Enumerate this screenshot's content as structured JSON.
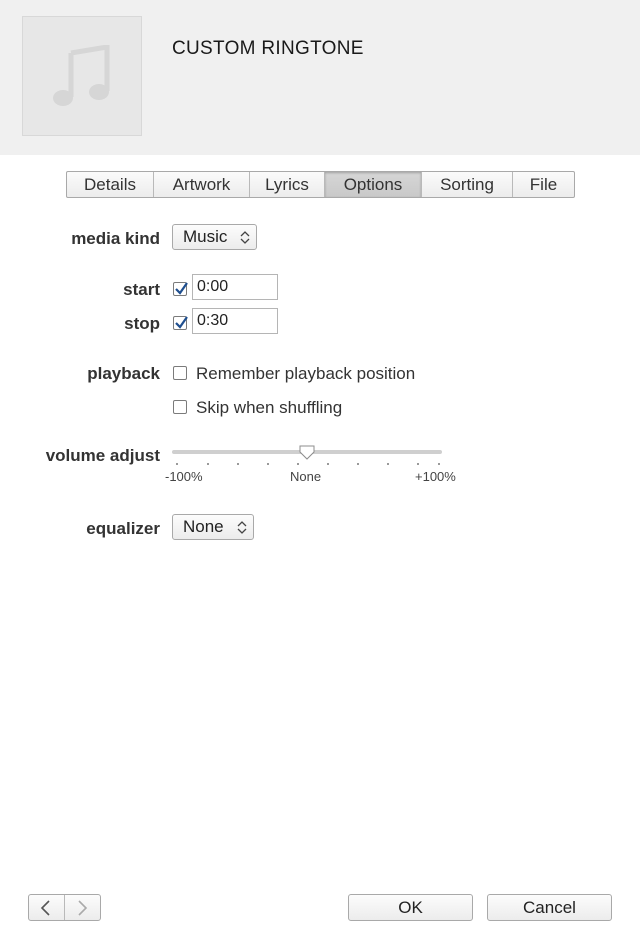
{
  "header": {
    "title": "CUSTOM RINGTONE",
    "artwork_icon": "music-note-icon"
  },
  "tabs": [
    {
      "label": "Details",
      "active": false
    },
    {
      "label": "Artwork",
      "active": false
    },
    {
      "label": "Lyrics",
      "active": false
    },
    {
      "label": "Options",
      "active": true
    },
    {
      "label": "Sorting",
      "active": false
    },
    {
      "label": "File",
      "active": false
    }
  ],
  "options": {
    "media_kind": {
      "label": "media kind",
      "value": "Music"
    },
    "start": {
      "label": "start",
      "checked": true,
      "value": "0:00"
    },
    "stop": {
      "label": "stop",
      "checked": true,
      "value": "0:30"
    },
    "playback": {
      "label": "playback",
      "remember_label": "Remember playback position",
      "remember_checked": false,
      "skip_label": "Skip when shuffling",
      "skip_checked": false
    },
    "volume": {
      "label": "volume adjust",
      "min_label": "-100%",
      "mid_label": "None",
      "max_label": "+100%",
      "value": 0
    },
    "equalizer": {
      "label": "equalizer",
      "value": "None"
    }
  },
  "footer": {
    "ok_label": "OK",
    "cancel_label": "Cancel",
    "prev_icon": "chevron-left-icon",
    "next_icon": "chevron-right-icon"
  }
}
